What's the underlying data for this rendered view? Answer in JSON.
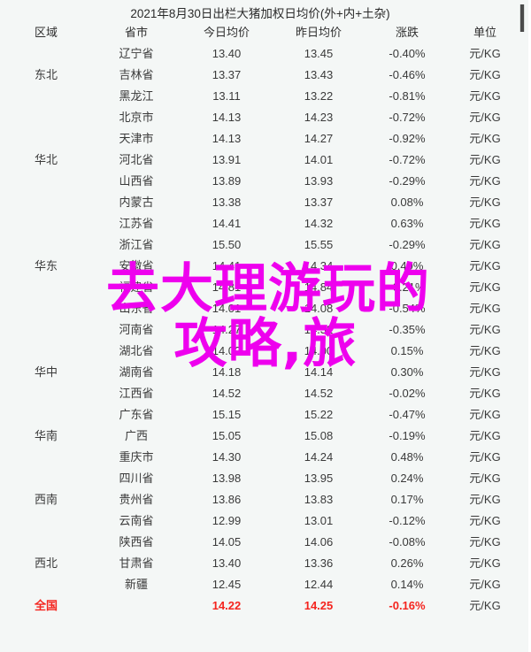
{
  "title": "2021年8月30日出栏大猪加权日均价(外+内+土杂)",
  "columns": [
    "区域",
    "省市",
    "今日均价",
    "昨日均价",
    "涨跌",
    "单位"
  ],
  "unit": "元/KG",
  "colors": {
    "background": "#f4f7f6",
    "text": "#3a3a3a",
    "total_row": "#f4241e",
    "overlay": "#ee00ee"
  },
  "rows": [
    {
      "region": "",
      "province": "辽宁省",
      "today": "13.40",
      "yesterday": "13.45",
      "change": "-0.40%",
      "unit": "元/KG"
    },
    {
      "region": "东北",
      "province": "吉林省",
      "today": "13.37",
      "yesterday": "13.43",
      "change": "-0.46%",
      "unit": "元/KG"
    },
    {
      "region": "",
      "province": "黑龙江",
      "today": "13.11",
      "yesterday": "13.22",
      "change": "-0.81%",
      "unit": "元/KG"
    },
    {
      "region": "",
      "province": "北京市",
      "today": "14.13",
      "yesterday": "14.23",
      "change": "-0.72%",
      "unit": "元/KG"
    },
    {
      "region": "",
      "province": "天津市",
      "today": "14.13",
      "yesterday": "14.27",
      "change": "-0.92%",
      "unit": "元/KG"
    },
    {
      "region": "华北",
      "province": "河北省",
      "today": "13.91",
      "yesterday": "14.01",
      "change": "-0.72%",
      "unit": "元/KG"
    },
    {
      "region": "",
      "province": "山西省",
      "today": "13.89",
      "yesterday": "13.93",
      "change": "-0.29%",
      "unit": "元/KG"
    },
    {
      "region": "",
      "province": "内蒙古",
      "today": "13.38",
      "yesterday": "13.37",
      "change": "0.08%",
      "unit": "元/KG"
    },
    {
      "region": "",
      "province": "江苏省",
      "today": "14.41",
      "yesterday": "14.32",
      "change": "0.63%",
      "unit": "元/KG"
    },
    {
      "region": "",
      "province": "浙江省",
      "today": "15.50",
      "yesterday": "15.55",
      "change": "-0.29%",
      "unit": "元/KG"
    },
    {
      "region": "华东",
      "province": "安徽省",
      "today": "14.41",
      "yesterday": "14.34",
      "change": "0.49%",
      "unit": "元/KG"
    },
    {
      "region": "",
      "province": "福建省",
      "today": "14.81",
      "yesterday": "14.84",
      "change": "-0.21%",
      "unit": "元/KG"
    },
    {
      "region": "",
      "province": "山东省",
      "today": "14.01",
      "yesterday": "14.08",
      "change": "-0.54%",
      "unit": "元/KG"
    },
    {
      "region": "",
      "province": "河南省",
      "today": "14.27",
      "yesterday": "14.32",
      "change": "-0.35%",
      "unit": "元/KG"
    },
    {
      "region": "",
      "province": "湖北省",
      "today": "14.02",
      "yesterday": "14.00",
      "change": "0.15%",
      "unit": "元/KG"
    },
    {
      "region": "华中",
      "province": "湖南省",
      "today": "14.18",
      "yesterday": "14.14",
      "change": "0.30%",
      "unit": "元/KG"
    },
    {
      "region": "",
      "province": "江西省",
      "today": "14.52",
      "yesterday": "14.52",
      "change": "-0.02%",
      "unit": "元/KG"
    },
    {
      "region": "",
      "province": "广东省",
      "today": "15.15",
      "yesterday": "15.22",
      "change": "-0.47%",
      "unit": "元/KG"
    },
    {
      "region": "华南",
      "province": "广西",
      "today": "15.05",
      "yesterday": "15.08",
      "change": "-0.19%",
      "unit": "元/KG"
    },
    {
      "region": "",
      "province": "重庆市",
      "today": "14.30",
      "yesterday": "14.24",
      "change": "0.48%",
      "unit": "元/KG"
    },
    {
      "region": "",
      "province": "四川省",
      "today": "13.98",
      "yesterday": "13.95",
      "change": "0.24%",
      "unit": "元/KG"
    },
    {
      "region": "西南",
      "province": "贵州省",
      "today": "13.86",
      "yesterday": "13.83",
      "change": "0.17%",
      "unit": "元/KG"
    },
    {
      "region": "",
      "province": "云南省",
      "today": "12.99",
      "yesterday": "13.01",
      "change": "-0.12%",
      "unit": "元/KG"
    },
    {
      "region": "",
      "province": "陕西省",
      "today": "14.05",
      "yesterday": "14.06",
      "change": "-0.08%",
      "unit": "元/KG"
    },
    {
      "region": "西北",
      "province": "甘肃省",
      "today": "13.40",
      "yesterday": "13.36",
      "change": "0.26%",
      "unit": "元/KG"
    },
    {
      "region": "",
      "province": "新疆",
      "today": "12.45",
      "yesterday": "12.44",
      "change": "0.14%",
      "unit": "元/KG"
    }
  ],
  "total_row": {
    "region": "全国",
    "province": "",
    "today": "14.22",
    "yesterday": "14.25",
    "change": "-0.16%",
    "unit": "元/KG"
  },
  "overlay": {
    "line1": "去大理游玩的",
    "line2": "攻略,旅"
  }
}
